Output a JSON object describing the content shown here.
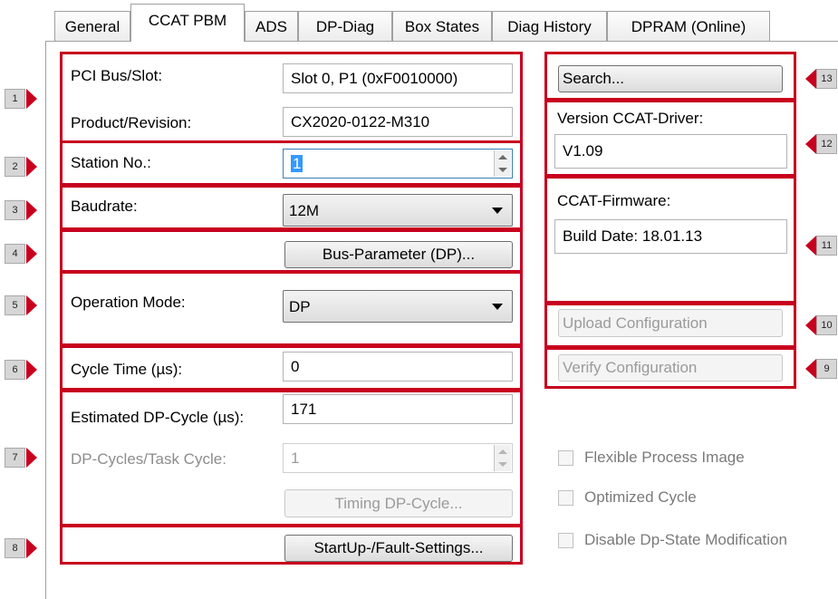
{
  "tabs": [
    "General",
    "CCAT PBM",
    "ADS",
    "DP-Diag",
    "Box States",
    "Diag History",
    "DPRAM (Online)"
  ],
  "pci_bus_slot": {
    "label": "PCI Bus/Slot:",
    "value": "Slot 0, P1 (0xF0010000)"
  },
  "product_revision": {
    "label": "Product/Revision:",
    "value": "CX2020-0122-M310"
  },
  "station_no": {
    "label": "Station No.:",
    "value": "1"
  },
  "baudrate": {
    "label": "Baudrate:",
    "value": "12M"
  },
  "bus_parameter_button": "Bus-Parameter (DP)...",
  "operation_mode": {
    "label": "Operation Mode:",
    "value": "DP"
  },
  "cycle_time": {
    "label": "Cycle Time (µs):",
    "value": "0"
  },
  "estimated_dp_cycle": {
    "label": "Estimated DP-Cycle (µs):",
    "value": "171"
  },
  "dp_cycles_task_cycle": {
    "label": "DP-Cycles/Task Cycle:",
    "value": "1"
  },
  "timing_dp_cycle_button": "Timing DP-Cycle...",
  "startup_fault_button": "StartUp-/Fault-Settings...",
  "search_button": "Search...",
  "version_ccat_driver": {
    "label": "Version CCAT-Driver:",
    "value": "V1.09"
  },
  "ccat_firmware": {
    "label": "CCAT-Firmware:",
    "value": "Build Date: 18.01.13"
  },
  "upload_configuration_button": "Upload Configuration",
  "verify_configuration_button": "Verify Configuration",
  "checkboxes": [
    "Flexible Process Image",
    "Optimized Cycle",
    "Disable Dp-State Modification"
  ],
  "markers": [
    "1",
    "2",
    "3",
    "4",
    "5",
    "6",
    "7",
    "8",
    "9",
    "10",
    "11",
    "12",
    "13"
  ],
  "colors": {
    "highlight": "#c8001e",
    "selection": "#3399ff",
    "disabled_text": "#9a9a9a"
  }
}
